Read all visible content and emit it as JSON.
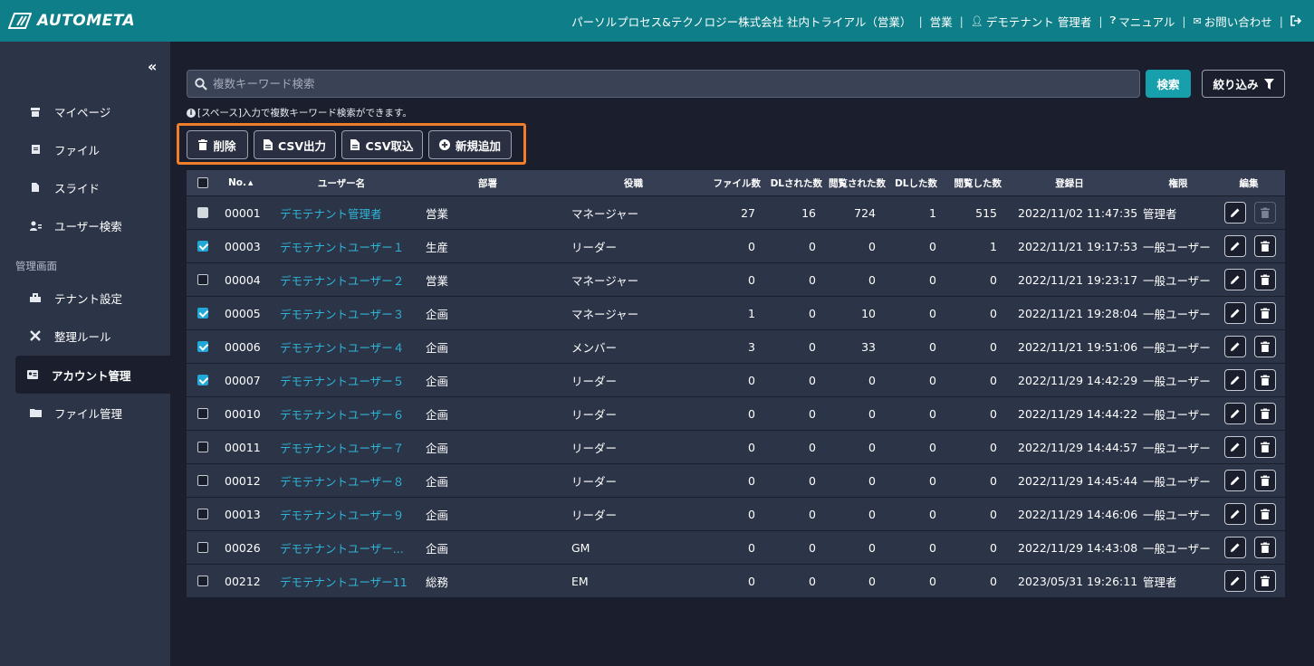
{
  "header": {
    "logo_text": "AUTOMETA",
    "company": "パーソルプロセス&テクノロジー株式会社 社内トライアル（営業）",
    "department": "営業",
    "user": "デモテナント 管理者",
    "manual": "マニュアル",
    "contact": "お問い合わせ"
  },
  "sidebar": {
    "collapse": "«",
    "items": [
      {
        "label": "マイページ",
        "icon": "home-icon"
      },
      {
        "label": "ファイル",
        "icon": "file-icon"
      },
      {
        "label": "スライド",
        "icon": "slide-icon"
      },
      {
        "label": "ユーザー検索",
        "icon": "user-search-icon"
      }
    ],
    "section_label": "管理画面",
    "admin_items": [
      {
        "label": "テナント設定",
        "icon": "building-icon"
      },
      {
        "label": "整理ルール",
        "icon": "tools-icon"
      },
      {
        "label": "アカウント管理",
        "icon": "id-card-icon",
        "active": true
      },
      {
        "label": "ファイル管理",
        "icon": "folder-icon"
      }
    ]
  },
  "search": {
    "placeholder": "複数キーワード検索",
    "button": "検索",
    "filter": "絞り込み",
    "hint": "[スペース]入力で複数キーワード検索ができます。"
  },
  "actions": {
    "delete": "削除",
    "csv_export": "CSV出力",
    "csv_import": "CSV取込",
    "add_new": "新規追加"
  },
  "table": {
    "headers": [
      "No.",
      "ユーザー名",
      "部署",
      "役職",
      "ファイル数",
      "DLされた数",
      "閲覧された数",
      "DLした数",
      "閲覧した数",
      "登録日",
      "権限",
      "編集"
    ],
    "sort_indicator": "▲",
    "rows": [
      {
        "checkbox": "disabled",
        "no": "00001",
        "name": "デモテナント管理者",
        "dept": "営業",
        "role": "マネージャー",
        "files": "27",
        "dl_received": "16",
        "viewed_received": "724",
        "dl_done": "1",
        "viewed_done": "515",
        "date": "2022/11/02 11:47:35",
        "auth": "管理者",
        "delete_disabled": true
      },
      {
        "checkbox": "checked",
        "no": "00003",
        "name": "デモテナントユーザー１",
        "dept": "生産",
        "role": "リーダー",
        "files": "0",
        "dl_received": "0",
        "viewed_received": "0",
        "dl_done": "0",
        "viewed_done": "1",
        "date": "2022/11/21 19:17:53",
        "auth": "一般ユーザー",
        "delete_disabled": false
      },
      {
        "checkbox": "unchecked",
        "no": "00004",
        "name": "デモテナントユーザー２",
        "dept": "営業",
        "role": "マネージャー",
        "files": "0",
        "dl_received": "0",
        "viewed_received": "0",
        "dl_done": "0",
        "viewed_done": "0",
        "date": "2022/11/21 19:23:17",
        "auth": "一般ユーザー",
        "delete_disabled": false
      },
      {
        "checkbox": "checked",
        "no": "00005",
        "name": "デモテナントユーザー３",
        "dept": "企画",
        "role": "マネージャー",
        "files": "1",
        "dl_received": "0",
        "viewed_received": "10",
        "dl_done": "0",
        "viewed_done": "0",
        "date": "2022/11/21 19:28:04",
        "auth": "一般ユーザー",
        "delete_disabled": false
      },
      {
        "checkbox": "checked",
        "no": "00006",
        "name": "デモテナントユーザー４",
        "dept": "企画",
        "role": "メンバー",
        "files": "3",
        "dl_received": "0",
        "viewed_received": "33",
        "dl_done": "0",
        "viewed_done": "0",
        "date": "2022/11/21 19:51:06",
        "auth": "一般ユーザー",
        "delete_disabled": false
      },
      {
        "checkbox": "checked",
        "no": "00007",
        "name": "デモテナントユーザー５",
        "dept": "企画",
        "role": "リーダー",
        "files": "0",
        "dl_received": "0",
        "viewed_received": "0",
        "dl_done": "0",
        "viewed_done": "0",
        "date": "2022/11/29 14:42:29",
        "auth": "一般ユーザー",
        "delete_disabled": false
      },
      {
        "checkbox": "unchecked",
        "no": "00010",
        "name": "デモテナントユーザー６",
        "dept": "企画",
        "role": "リーダー",
        "files": "0",
        "dl_received": "0",
        "viewed_received": "0",
        "dl_done": "0",
        "viewed_done": "0",
        "date": "2022/11/29 14:44:22",
        "auth": "一般ユーザー",
        "delete_disabled": false
      },
      {
        "checkbox": "unchecked",
        "no": "00011",
        "name": "デモテナントユーザー７",
        "dept": "企画",
        "role": "リーダー",
        "files": "0",
        "dl_received": "0",
        "viewed_received": "0",
        "dl_done": "0",
        "viewed_done": "0",
        "date": "2022/11/29 14:44:57",
        "auth": "一般ユーザー",
        "delete_disabled": false
      },
      {
        "checkbox": "unchecked",
        "no": "00012",
        "name": "デモテナントユーザー８",
        "dept": "企画",
        "role": "リーダー",
        "files": "0",
        "dl_received": "0",
        "viewed_received": "0",
        "dl_done": "0",
        "viewed_done": "0",
        "date": "2022/11/29 14:45:44",
        "auth": "一般ユーザー",
        "delete_disabled": false
      },
      {
        "checkbox": "unchecked",
        "no": "00013",
        "name": "デモテナントユーザー９",
        "dept": "企画",
        "role": "リーダー",
        "files": "0",
        "dl_received": "0",
        "viewed_received": "0",
        "dl_done": "0",
        "viewed_done": "0",
        "date": "2022/11/29 14:46:06",
        "auth": "一般ユーザー",
        "delete_disabled": false
      },
      {
        "checkbox": "unchecked",
        "no": "00026",
        "name": "デモテナントユーザー...",
        "dept": "企画",
        "role": "GM",
        "files": "0",
        "dl_received": "0",
        "viewed_received": "0",
        "dl_done": "0",
        "viewed_done": "0",
        "date": "2022/11/29 14:43:08",
        "auth": "一般ユーザー",
        "delete_disabled": false
      },
      {
        "checkbox": "unchecked",
        "no": "00212",
        "name": "デモテナントユーザー11",
        "dept": "総務",
        "role": "EM",
        "files": "0",
        "dl_received": "0",
        "viewed_received": "0",
        "dl_done": "0",
        "viewed_done": "0",
        "date": "2023/05/31 19:26:11",
        "auth": "管理者",
        "delete_disabled": false
      }
    ]
  }
}
